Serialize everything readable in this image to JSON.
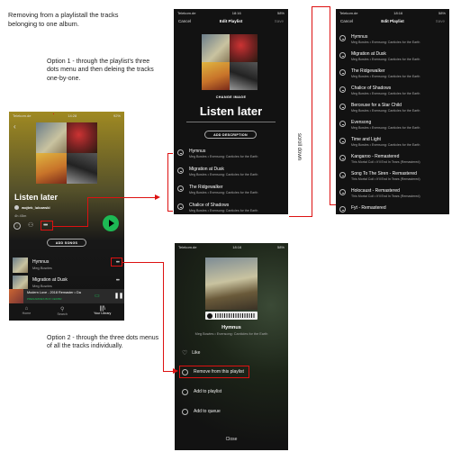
{
  "notes": {
    "intro": "Removing from a playlistall the tracks belonging to one album.",
    "option1": "Option 1 - through the  playlist's three dots menu and then deleing the tracks one-by-one.",
    "option2": "Option 2 - through the  three dots menus of all the tracks individually.",
    "scroll": "scroll down"
  },
  "phone_playlist": {
    "status": {
      "carrier": "Telekom.de",
      "time": "14:28",
      "battery": "92%"
    },
    "title": "Listen later",
    "owner": "wojtek_lukowski",
    "duration": "4h 45m",
    "add_songs": "ADD SONGS",
    "tracks": [
      {
        "title": "Hymnus",
        "artist": "Meg Bowles"
      },
      {
        "title": "Migration at Dusk",
        "artist": "Meg Bowles"
      }
    ],
    "mini_player": {
      "title": "Modern Love - 2018 Remaster",
      "artist": "Da",
      "device": "PRENARIDES BOX CEFIBR"
    },
    "nav": [
      {
        "label": "Home"
      },
      {
        "label": "Search"
      },
      {
        "label": "Your Library"
      }
    ]
  },
  "phone_edit": {
    "status": {
      "carrier": "Telekom.de",
      "time": "18:16",
      "battery": "58%"
    },
    "cancel": "Cancel",
    "header": "Edit Playlist",
    "save": "Save",
    "change_image": "CHANGE IMAGE",
    "title": "Listen later",
    "add_description": "ADD DESCRIPTION",
    "tracks": [
      {
        "title": "Hymnus",
        "sub": "Meg Bowles • Evensong: Canticles for the Earth"
      },
      {
        "title": "Migration at Dusk",
        "sub": "Meg Bowles • Evensong: Canticles for the Earth"
      },
      {
        "title": "The Ridgewalker",
        "sub": "Meg Bowles • Evensong: Canticles for the Earth"
      },
      {
        "title": "Chalice of Shadows",
        "sub": "Meg Bowles • Evensong: Canticles for the Earth"
      }
    ]
  },
  "phone_edit_scrolled": {
    "status": {
      "carrier": "Telekom.de",
      "time": "18:16",
      "battery": "58%"
    },
    "cancel": "Cancel",
    "header": "Edit Playlist",
    "save": "Save",
    "tracks": [
      {
        "title": "Hymnus",
        "sub": "Meg Bowles • Evensong: Canticles for the Earth"
      },
      {
        "title": "Migration at Dusk",
        "sub": "Meg Bowles • Evensong: Canticles for the Earth"
      },
      {
        "title": "The Ridgewalker",
        "sub": "Meg Bowles • Evensong: Canticles for the Earth"
      },
      {
        "title": "Chalice of Shadows",
        "sub": "Meg Bowles • Evensong: Canticles for the Earth"
      },
      {
        "title": "Berceuse for a Star Child",
        "sub": "Meg Bowles • Evensong: Canticles for the Earth"
      },
      {
        "title": "Evensong",
        "sub": "Meg Bowles • Evensong: Canticles for the Earth"
      },
      {
        "title": "Time and Light",
        "sub": "Meg Bowles • Evensong: Canticles for the Earth"
      },
      {
        "title": "Kangaroo - Remastered",
        "sub": "This Mortal Coil • It'll End In Tears (Remastered)"
      },
      {
        "title": "Song To The Siren - Remastered",
        "sub": "This Mortal Coil • It'll End In Tears (Remastered)"
      },
      {
        "title": "Holocaust - Remastered",
        "sub": "This Mortal Coil • It'll End In Tears (Remastered)"
      },
      {
        "title": "Fyt - Remastered",
        "sub": ""
      }
    ]
  },
  "phone_track_menu": {
    "status": {
      "carrier": "Telekom.de",
      "time": "18:16",
      "battery": "58%"
    },
    "track_title": "Hymnus",
    "track_sub": "Meg Bowles • Evensong: Canticles for the Earth",
    "options": [
      {
        "label": "Like",
        "icon": "heart-icon"
      },
      {
        "label": "Remove from this playlist",
        "icon": "remove-icon"
      },
      {
        "label": "Add to playlist",
        "icon": "add-playlist-icon"
      },
      {
        "label": "Add to queue",
        "icon": "queue-icon"
      }
    ],
    "close": "Close"
  },
  "colors": {
    "spotify_green": "#1db954",
    "highlight": "#dd1111"
  }
}
